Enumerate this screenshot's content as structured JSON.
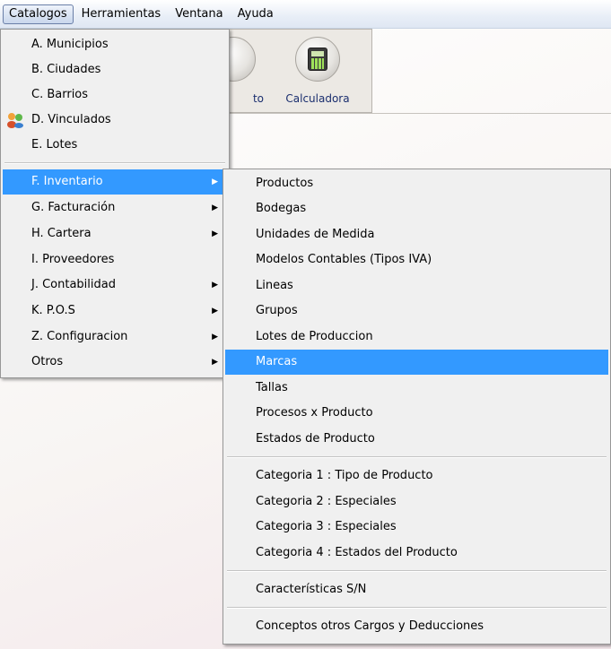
{
  "menubar": {
    "items": [
      {
        "label": "Catalogos",
        "active": true
      },
      {
        "label": "Herramientas"
      },
      {
        "label": "Ventana"
      },
      {
        "label": "Ayuda"
      }
    ]
  },
  "toolbar": {
    "partial_label": "to",
    "calculator_label": "Calculadora"
  },
  "catalogos_menu": {
    "items": [
      "A. Municipios",
      "B. Ciudades",
      "C. Barrios",
      "D. Vinculados",
      "E. Lotes",
      "F. Inventario",
      "G. Facturación",
      "H. Cartera",
      "I. Proveedores",
      "J. Contabilidad",
      "K. P.O.S",
      "Z. Configuracion",
      "Otros"
    ],
    "selected": "F. Inventario"
  },
  "inventario_submenu": {
    "items": [
      "Productos",
      "Bodegas",
      "Unidades de Medida",
      "Modelos Contables (Tipos IVA)",
      "Lineas",
      "Grupos",
      "Lotes de Produccion",
      "Marcas",
      "Tallas",
      "Procesos x Producto",
      "Estados de Producto",
      "Categoria 1 : Tipo de Producto",
      "Categoria 2 : Especiales",
      "Categoria 3 : Especiales",
      "Categoria 4 : Estados del Producto",
      "Características S/N",
      "Conceptos otros Cargos y Deducciones"
    ],
    "highlighted": "Marcas"
  },
  "colors": {
    "highlight": "#3399ff",
    "menu_background": "#f0f0f0",
    "toolbar_label": "#1a2e6e"
  }
}
